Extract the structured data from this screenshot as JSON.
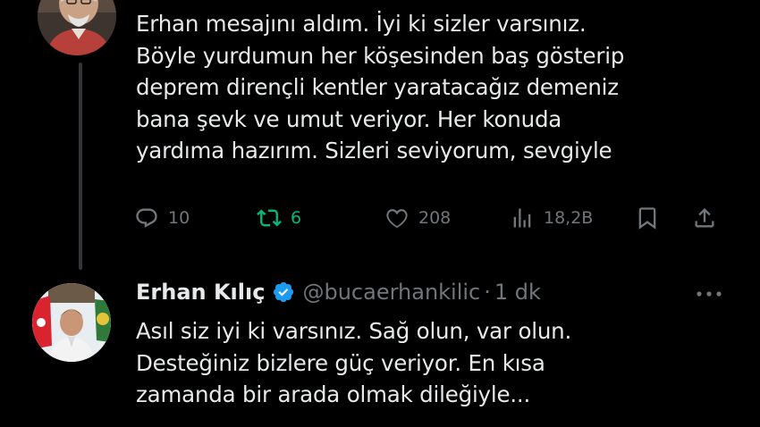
{
  "tweet1": {
    "text": "Erhan mesajını aldım. İyi ki sizler varsınız.\nBöyle yurdumun her köşesinden baş gösterip\ndeprem dirençli kentler yaratacağız demeniz\nbana şevk ve umut veriyor.  Her konuda\nyardıma hazırım. Sizleri seviyorum, sevgiyle",
    "replies": "10",
    "retweets": "6",
    "likes": "208",
    "views": "18,2B"
  },
  "tweet2": {
    "name": "Erhan Kılıç",
    "handle": "@bucaerhankilic",
    "separator": "·",
    "time": "1 dk",
    "text": "Asıl siz iyi ki varsınız. Sağ olun, var olun.\nDesteğiniz bizlere güç veriyor. En kısa\nzamanda bir arada olmak dileğiyle..."
  },
  "colors": {
    "background": "#000000",
    "text": "#e7e9ea",
    "muted": "#71767b",
    "retweet_active": "#00ba7c",
    "verified": "#1d9bf0"
  },
  "icons": [
    "reply-icon",
    "retweet-icon",
    "like-icon",
    "views-icon",
    "bookmark-icon",
    "share-icon",
    "verified-badge-icon",
    "more-icon"
  ]
}
